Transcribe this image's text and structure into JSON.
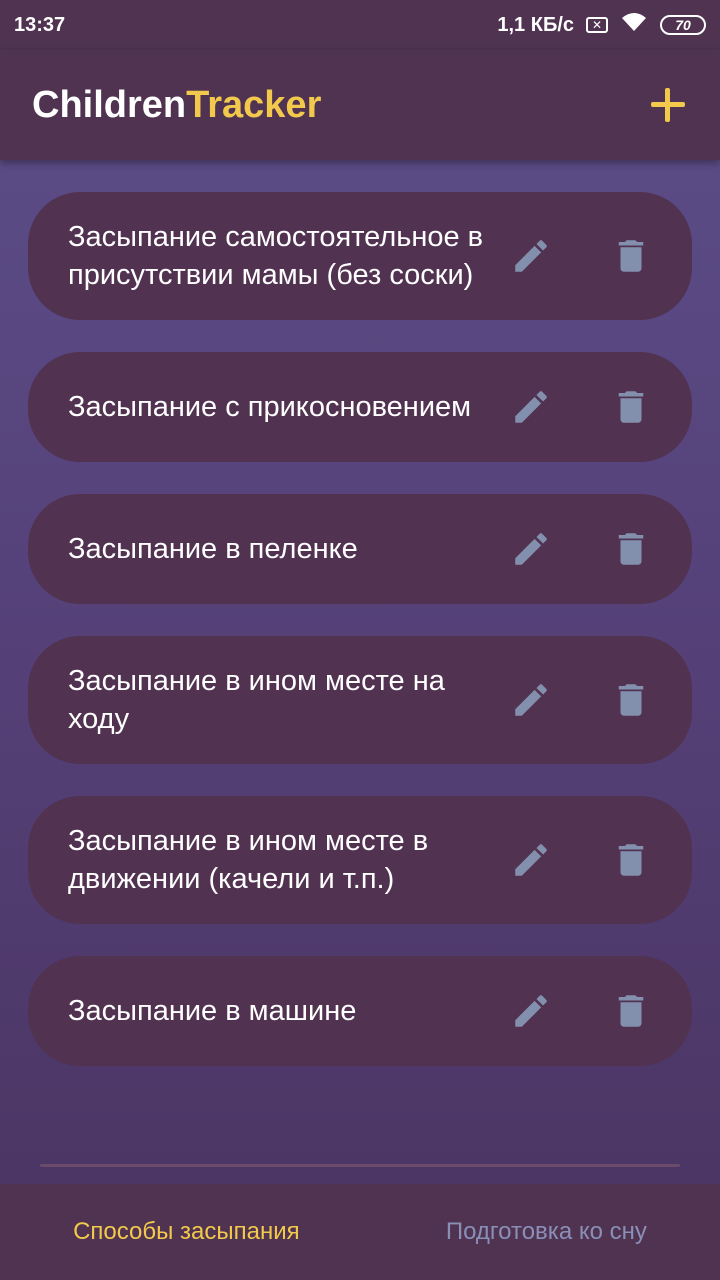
{
  "status_bar": {
    "time": "13:37",
    "network_speed": "1,1 КБ/с",
    "sim_icon_glyph": "✕",
    "battery": "70"
  },
  "app_bar": {
    "title_part1": "Children",
    "title_part2": "Tracker",
    "add_icon": "plus-icon"
  },
  "items": [
    {
      "label": "Засыпание самостоятельное в присутствии мамы (без соски)"
    },
    {
      "label": "Засыпание с прикосновением"
    },
    {
      "label": "Засыпание в пеленке"
    },
    {
      "label": "Засыпание в ином месте на ходу"
    },
    {
      "label": "Засыпание в ином месте в движении (качели и т.п.)"
    },
    {
      "label": "Засыпание в машине"
    }
  ],
  "bottom_nav": {
    "tabs": [
      {
        "label": "Способы засыпания",
        "active": true
      },
      {
        "label": "Подготовка ко сну",
        "active": false
      }
    ]
  },
  "colors": {
    "accent": "#f2c94c",
    "card": "#523251",
    "bar": "#4f3350",
    "icon": "#8290ad",
    "inactive_tab": "#8a8fb8"
  }
}
